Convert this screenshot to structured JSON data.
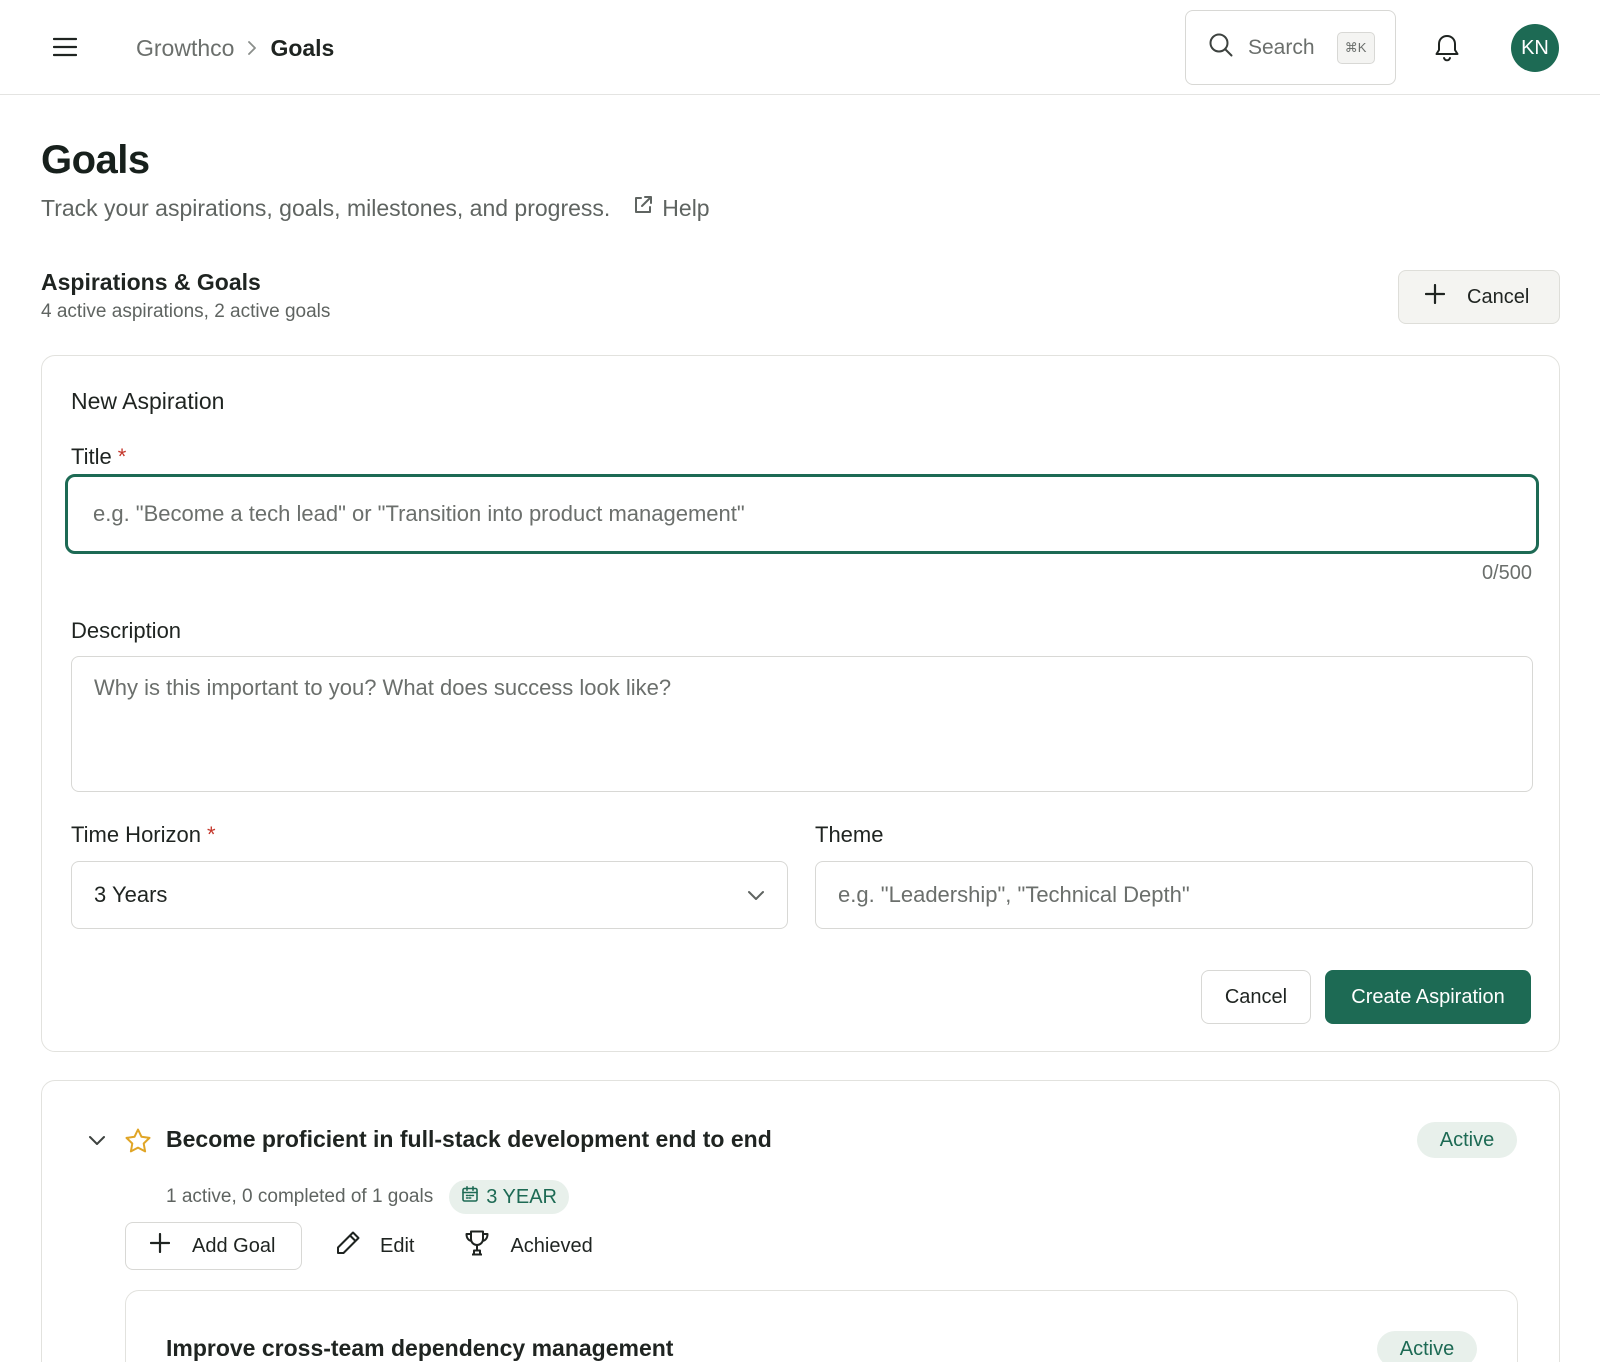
{
  "header": {
    "breadcrumb_root": "Growthco",
    "breadcrumb_current": "Goals",
    "search_label": "Search",
    "search_shortcut": "⌘K",
    "avatar_initials": "KN"
  },
  "page": {
    "title": "Goals",
    "subtitle": "Track your aspirations, goals, milestones, and progress.",
    "help_label": "Help"
  },
  "section": {
    "title": "Aspirations & Goals",
    "summary": "4 active aspirations, 2 active goals",
    "cancel_label": "Cancel"
  },
  "form": {
    "heading": "New Aspiration",
    "title_label": "Title",
    "required_mark": "*",
    "title_placeholder": "e.g. \"Become a tech lead\" or \"Transition into product management\"",
    "title_value": "",
    "counter": "0/500",
    "description_label": "Description",
    "description_placeholder": "Why is this important to you? What does success look like?",
    "time_horizon_label": "Time Horizon",
    "time_horizon_value": "3 Years",
    "theme_label": "Theme",
    "theme_placeholder": "e.g. \"Leadership\", \"Technical Depth\"",
    "cancel_label": "Cancel",
    "create_label": "Create Aspiration"
  },
  "aspiration": {
    "title": "Become proficient in full-stack development end to end",
    "status": "Active",
    "meta": "1 active, 0 completed of 1 goals",
    "horizon": "3 YEAR",
    "add_goal_label": "Add Goal",
    "edit_label": "Edit",
    "achieved_label": "Achieved",
    "goal": {
      "title": "Improve cross-team dependency management",
      "status": "Active"
    }
  },
  "colors": {
    "accent": "#1d6a54",
    "badge_bg": "#e8f0eb",
    "required": "#c4362b",
    "star": "#e0a526"
  }
}
